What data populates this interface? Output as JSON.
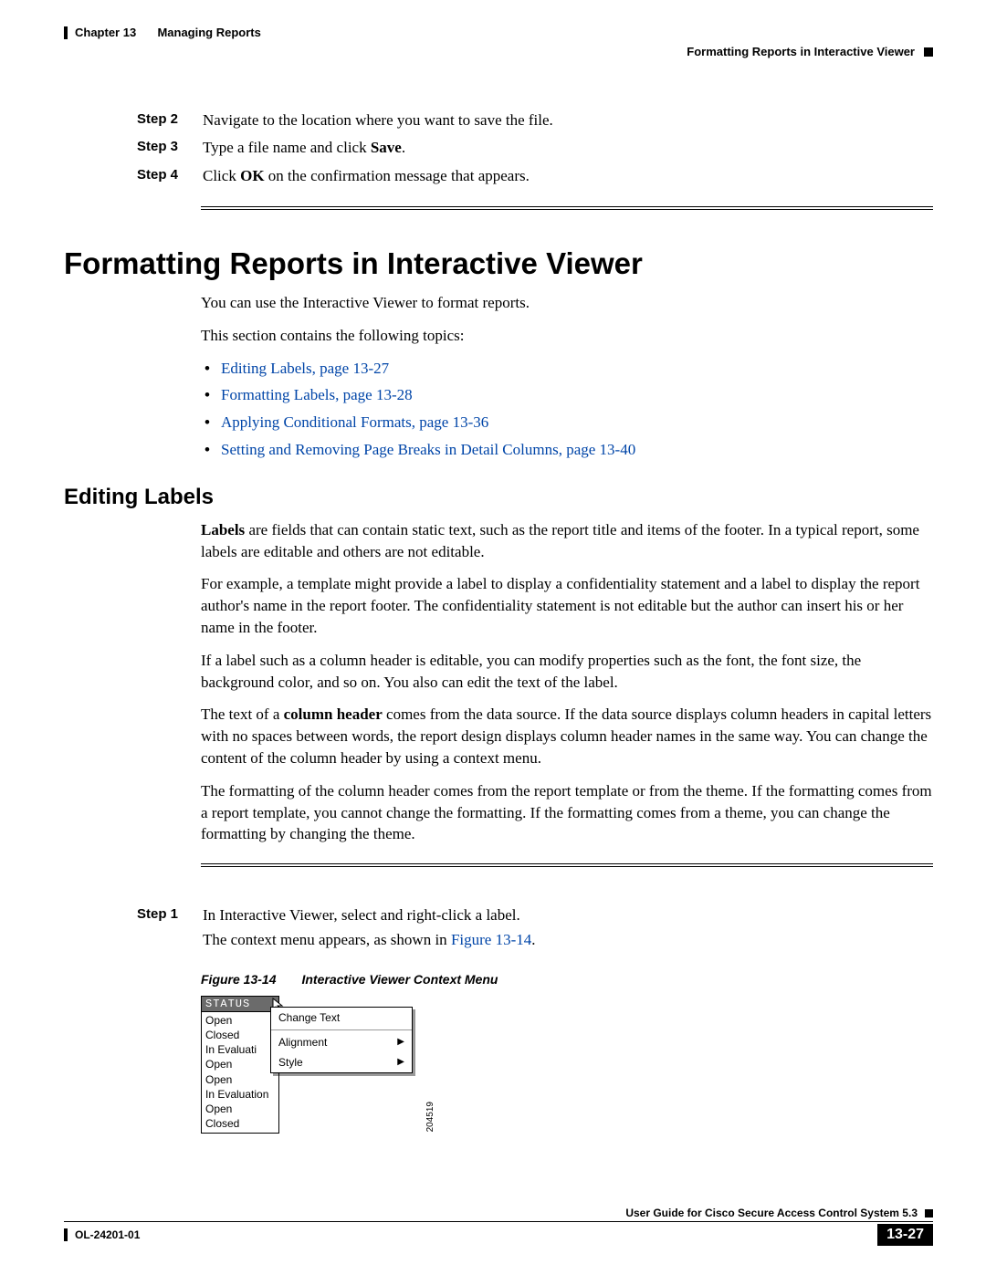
{
  "header": {
    "chapter": "Chapter 13",
    "chapter_title": "Managing Reports",
    "section_title": "Formatting Reports in Interactive Viewer"
  },
  "steps_top": [
    {
      "label": "Step 2",
      "text": "Navigate to the location where you want to save the file."
    },
    {
      "label": "Step 3",
      "html": "Type a file name and click <b class='sans'>Save</b>."
    },
    {
      "label": "Step 4",
      "html": "Click <b class='sans'>OK</b> on the confirmation message that appears."
    }
  ],
  "h1": "Formatting Reports in Interactive Viewer",
  "intro": {
    "p1": "You can use the Interactive Viewer to format reports.",
    "p2": "This section contains the following topics:"
  },
  "toc_links": [
    "Editing Labels, page 13-27",
    "Formatting Labels, page 13-28",
    "Applying Conditional Formats, page 13-36",
    "Setting and Removing Page Breaks in Detail Columns, page 13-40"
  ],
  "h2": "Editing Labels",
  "editing_paras": {
    "p1": "<b class='sans'>Labels</b> are fields that can contain static text, such as the report title and items of the footer. In a typical report, some labels are editable and others are not editable.",
    "p2": "For example, a template might provide a label to display a confidentiality statement and a label to display the report author's name in the report footer. The confidentiality statement is not editable but the author can insert his or her name in the footer.",
    "p3": "If a label such as a column header is editable, you can modify properties such as the font, the font size, the background color, and so on. You also can edit the text of the label.",
    "p4": "The text of a <b class='sans'>column header</b> comes from the data source. If the data source displays column headers in capital letters with no spaces between words, the report design displays column header names in the same way. You can change the content of the column header by using a context menu.",
    "p5": "The formatting of the column header comes from the report template or from the theme. If the formatting comes from a report template, you cannot change the formatting. If the formatting comes from a theme, you can change the formatting by changing the theme."
  },
  "steps_bottom": [
    {
      "label": "Step 1",
      "line1": "In Interactive Viewer, select and right-click a label.",
      "line2_pre": "The context menu appears, as shown in ",
      "line2_link": "Figure 13-14",
      "line2_post": "."
    }
  ],
  "figure": {
    "num": "Figure 13-14",
    "title": "Interactive Viewer Context Menu",
    "status_head": "STATUS",
    "status_items": [
      "Open",
      "Closed",
      "In Evaluati",
      "Open",
      "Open",
      "In Evaluation",
      "Open",
      "Closed"
    ],
    "menu": [
      "Change Text",
      "Alignment",
      "Style"
    ],
    "ref_id": "204519"
  },
  "footer": {
    "guide": "User Guide for Cisco Secure Access Control System 5.3",
    "doc_id": "OL-24201-01",
    "page": "13-27"
  }
}
